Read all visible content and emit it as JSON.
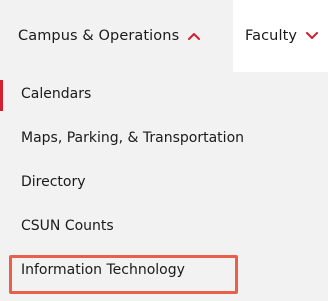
{
  "nav": {
    "tabs": [
      {
        "label": "Campus & Operations",
        "icon": "chevron-up-icon",
        "state": "expanded"
      },
      {
        "label": "Faculty",
        "icon": "chevron-down-icon",
        "state": "collapsed"
      }
    ]
  },
  "menu": {
    "items": [
      {
        "label": "Calendars",
        "current": true
      },
      {
        "label": "Maps, Parking, & Transportation"
      },
      {
        "label": "Directory"
      },
      {
        "label": "CSUN Counts"
      },
      {
        "label": "Information Technology",
        "highlighted": true
      }
    ]
  },
  "colors": {
    "accent": "#d22030",
    "highlight_border": "#e8604a",
    "dropdown_bg": "#f2f2f2",
    "nav_bg": "#ffffff"
  }
}
